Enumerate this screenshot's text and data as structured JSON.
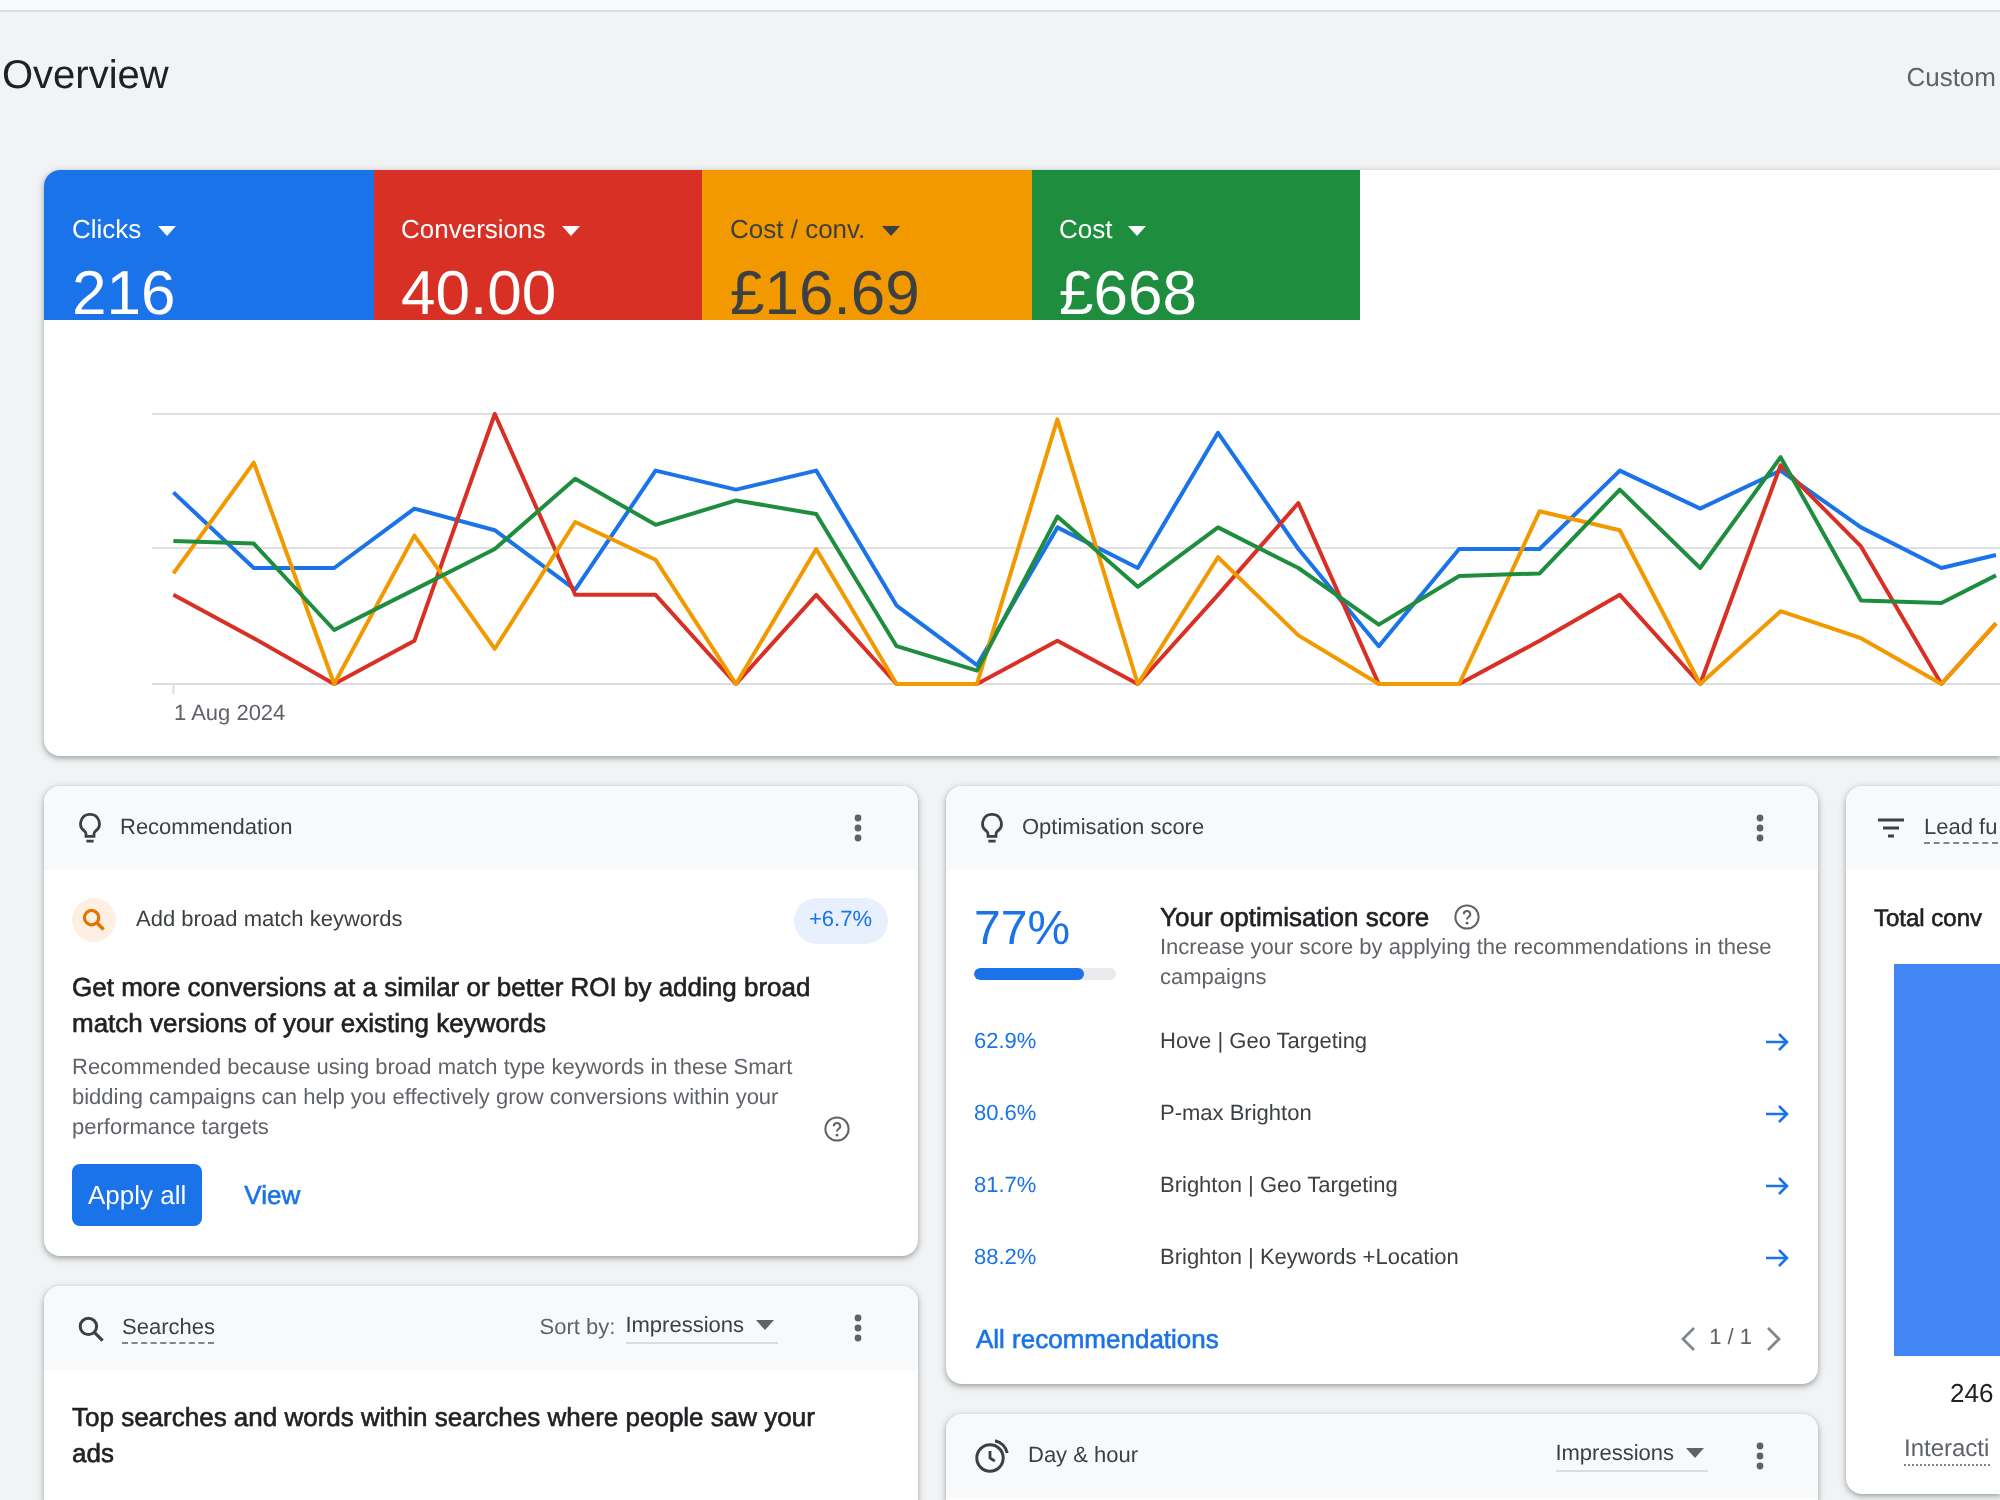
{
  "header": {
    "title": "Overview",
    "date_range": "Custom"
  },
  "metrics": [
    {
      "label": "Clicks",
      "value": "216",
      "color": "#1a73e8",
      "selected": true
    },
    {
      "label": "Conversions",
      "value": "40.00",
      "color": "#d93025",
      "selected": true
    },
    {
      "label": "Cost / conv.",
      "value": "£16.69",
      "color": "#f29900",
      "selected": true
    },
    {
      "label": "Cost",
      "value": "£668",
      "color": "#1e8e3e",
      "selected": true
    }
  ],
  "chart": {
    "x_label": "1 Aug 2024"
  },
  "recommendation": {
    "title": "Recommendation",
    "suggestion": "Add broad match keywords",
    "uplift": "+6.7%",
    "headline": "Get more conversions at a similar or better ROI by adding broad match versions of your existing keywords",
    "reason": "Recommended because using broad match type keywords in these Smart bidding campaigns can help you effectively grow conversions within your performance targets",
    "buttons": [
      {
        "label": "Apply all",
        "kind": "primary"
      },
      {
        "label": "View",
        "kind": "text"
      }
    ]
  },
  "searches": {
    "title": "Searches",
    "sort_label": "Sort by:",
    "sort_value": "Impressions",
    "description": "Top searches and words within searches where people saw your ads"
  },
  "optimisation": {
    "title": "Optimisation score",
    "score": "77%",
    "level": 0.77,
    "heading": "Your optimisation score",
    "description": "Increase your score by applying the recommendations in these campaigns",
    "campaigns": [
      {
        "score": "62.9%",
        "name": "Hove | Geo Targeting"
      },
      {
        "score": "80.6%",
        "name": "P-max Brighton"
      },
      {
        "score": "81.7%",
        "name": "Brighton | Geo Targeting"
      },
      {
        "score": "88.2%",
        "name": "Brighton | Keywords +Location"
      }
    ],
    "link": "All recommendations",
    "pager": "1 / 1"
  },
  "day_hour": {
    "title": "Day & hour",
    "metric": "Impressions"
  },
  "lead_card": {
    "title": "Lead fu",
    "heading": "Total conv",
    "value": "246",
    "category": "Interacti"
  }
}
